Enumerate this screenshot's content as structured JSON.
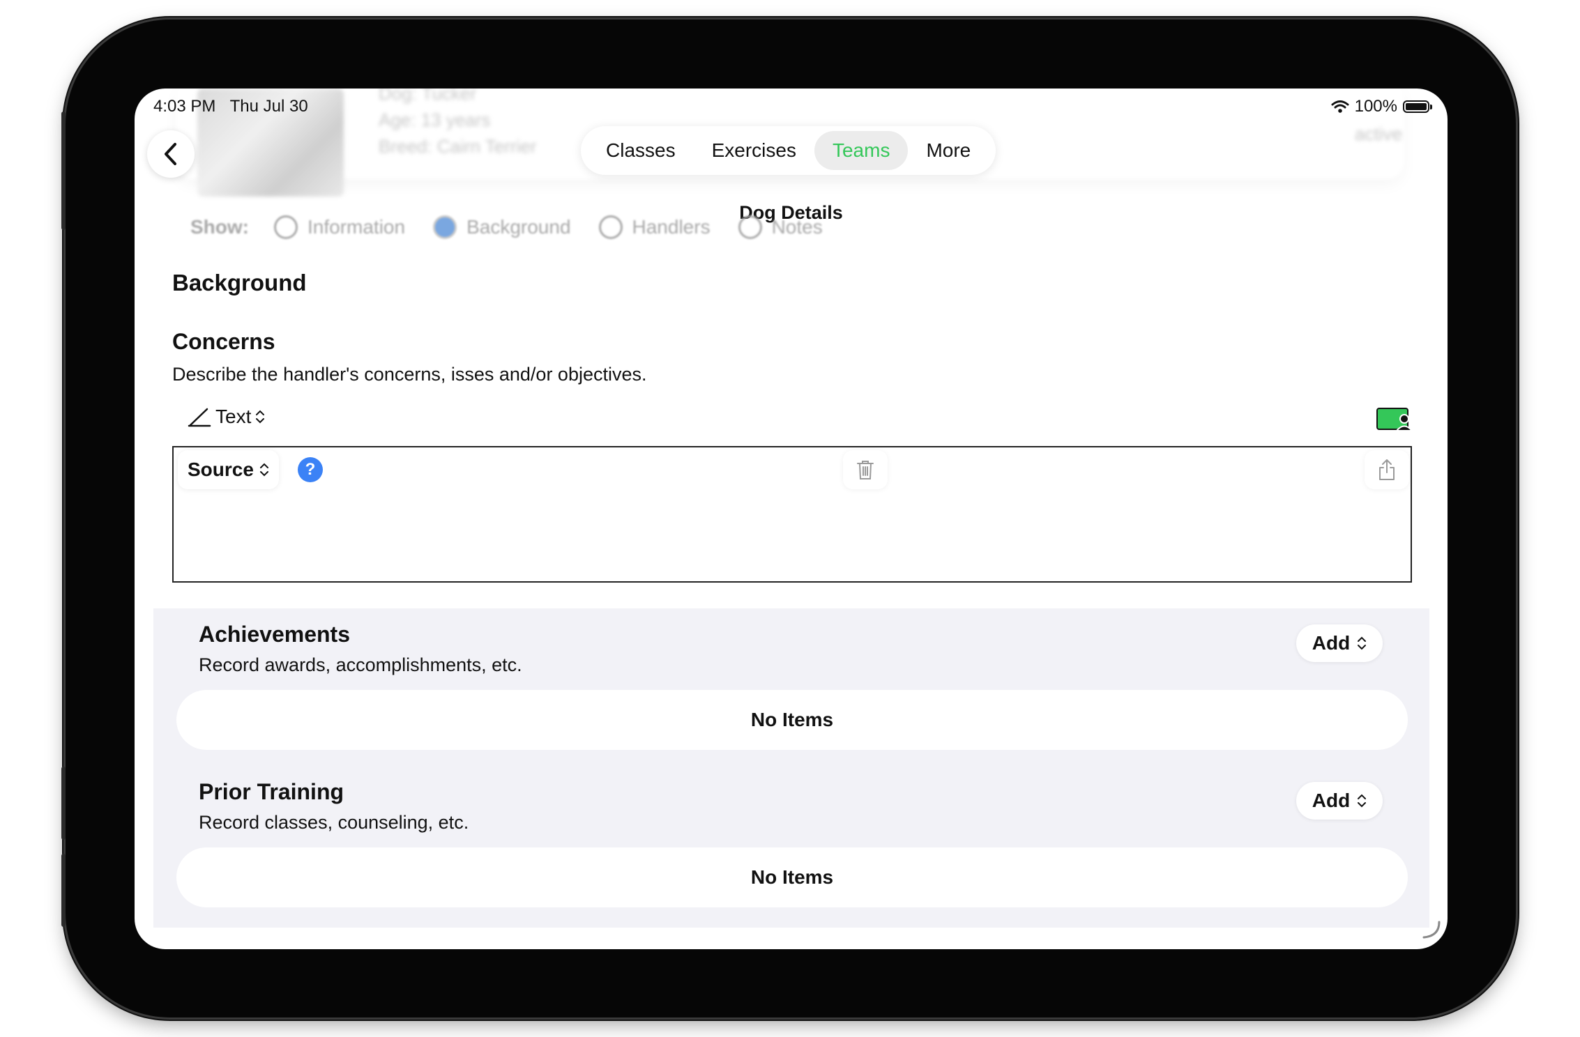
{
  "status_bar": {
    "time": "4:03 PM",
    "date": "Thu Jul 30",
    "battery": "100%"
  },
  "background_header": {
    "line1": "Dog: Tucker",
    "line2": "Age: 13 years",
    "line3": "Breed: Cairn Terrier",
    "status": "active"
  },
  "tabs": [
    {
      "label": "Classes",
      "active": false
    },
    {
      "label": "Exercises",
      "active": false
    },
    {
      "label": "Teams",
      "active": true
    },
    {
      "label": "More",
      "active": false
    }
  ],
  "nav_title": "Dog Details",
  "show_filter": {
    "label": "Show:",
    "options": [
      {
        "label": "Information",
        "selected": false
      },
      {
        "label": "Background",
        "selected": true
      },
      {
        "label": "Handlers",
        "selected": false
      },
      {
        "label": "Notes",
        "selected": false
      }
    ]
  },
  "section_title": "Background",
  "concerns": {
    "title": "Concerns",
    "description": "Describe the handler's concerns, isses and/or objectives.",
    "format_picker": "Text",
    "source_label": "Source",
    "help_label": "?"
  },
  "achievements": {
    "title": "Achievements",
    "description": "Record awards, accomplishments, etc.",
    "add_label": "Add",
    "empty_label": "No Items"
  },
  "prior_training": {
    "title": "Prior Training",
    "description": "Record classes, counseling, etc.",
    "add_label": "Add",
    "empty_label": "No Items"
  },
  "colors": {
    "accent_green": "#34c759",
    "help_blue": "#3b82f6",
    "group_bg": "#f2f2f7"
  },
  "icons": [
    "back-chevron-icon",
    "wifi-icon",
    "battery-icon",
    "pencil-icon",
    "updown-chevron-icon",
    "person-card-icon",
    "help-icon",
    "trash-icon",
    "share-icon",
    "resize-icon"
  ]
}
